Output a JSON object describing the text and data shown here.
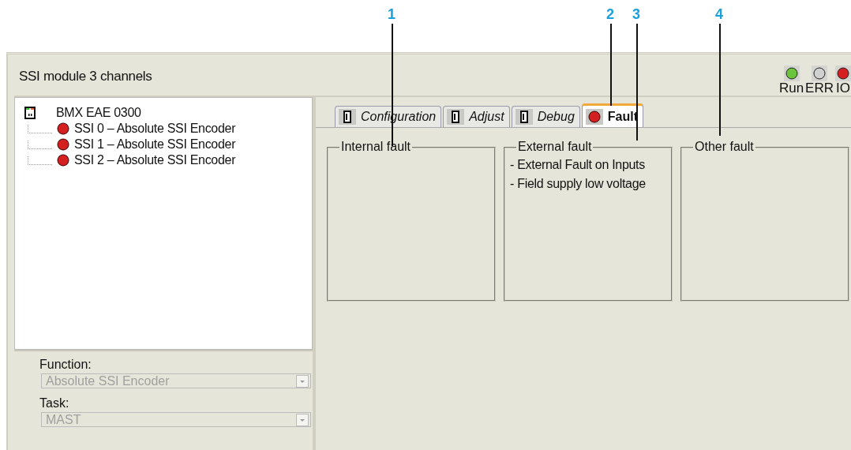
{
  "callouts": [
    {
      "label": "1"
    },
    {
      "label": "2"
    },
    {
      "label": "3"
    },
    {
      "label": "4"
    }
  ],
  "window": {
    "title": "SSI module 3 channels"
  },
  "leds": [
    {
      "label": "Run",
      "color": "#6cc33c"
    },
    {
      "label": "ERR",
      "color": "#d0d0d0"
    },
    {
      "label": "IO",
      "color": "#d42020"
    }
  ],
  "tree": {
    "label": "BMX EAE 0300",
    "children": [
      {
        "label": "SSI 0 – Absolute SSI Encoder",
        "color": "#d42020"
      },
      {
        "label": "SSI 1 – Absolute SSI Encoder",
        "color": "#d42020"
      },
      {
        "label": "SSI 2 – Absolute SSI Encoder",
        "color": "#d42020"
      }
    ]
  },
  "settings": [
    {
      "label": "Function:",
      "value": "Absolute SSI Encoder",
      "disabled": true
    },
    {
      "label": "Task:",
      "value": "MAST",
      "disabled": true
    }
  ],
  "tabs": [
    {
      "label": "Configuration",
      "kind": "module",
      "selected": false
    },
    {
      "label": "Adjust",
      "kind": "module",
      "selected": false
    },
    {
      "label": "Debug",
      "kind": "module",
      "selected": false
    },
    {
      "label": "Fault",
      "kind": "fault",
      "selected": true
    }
  ],
  "fault_groups": [
    {
      "title": "Internal fault"
    },
    {
      "title": "External fault",
      "items": [
        "- External Fault on Inputs",
        "- Field supply low voltage"
      ]
    },
    {
      "title": "Other fault"
    }
  ]
}
